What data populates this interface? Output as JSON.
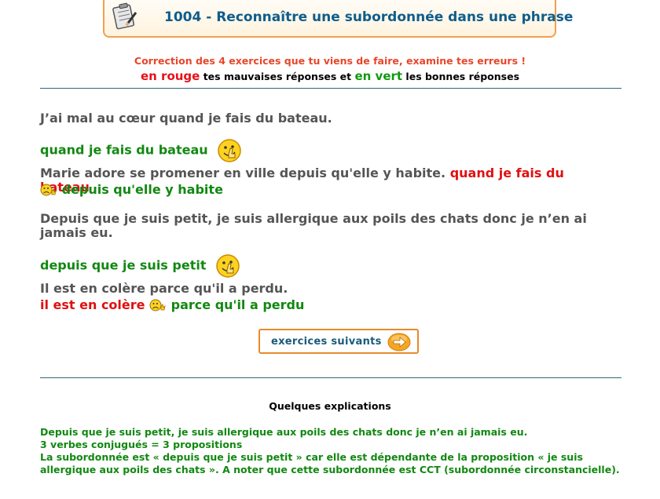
{
  "header": {
    "title": "1004 - Reconnaître une subordonnée dans une phrase",
    "icon": "clipboard-pencil-icon"
  },
  "intro": {
    "line1": "Correction des 4 exercices que tu viens de faire, examine tes erreurs !",
    "red_label": "en rouge",
    "middle": " tes mauvaises réponses et ",
    "green_label": "en vert",
    "end": " les bonnes réponses"
  },
  "exercises": [
    {
      "question": "J’ai mal au cœur quand je fais du bateau.",
      "correct": "quand je fais du bateau",
      "result_icon": "thumbs-up-smiley-icon"
    },
    {
      "question": "Marie adore se promener en ville depuis qu'elle y habite.",
      "wrong": "quand je fais du bateau",
      "correct": "depuis qu'elle y habite",
      "result_icon": "sad-smiley-icon"
    },
    {
      "question": "Depuis que je suis petit, je suis allergique aux poils des chats donc je n’en ai jamais eu.",
      "correct": "depuis que je suis petit",
      "result_icon": "thumbs-up-smiley-icon"
    },
    {
      "question": "Il est en colère parce qu'il a perdu.",
      "wrong": "il est en colère",
      "correct": "parce qu'il a perdu",
      "result_icon": "sad-smiley-icon"
    }
  ],
  "next_button": {
    "label": "exercices suivants",
    "icon": "arrow-right-icon"
  },
  "explanations": {
    "title": "Quelques explications",
    "lines": [
      "Depuis que je suis petit, je suis allergique aux poils des chats donc je n’en ai jamais eu.",
      "3 verbes conjugués = 3 propositions",
      "La subordonnée est « depuis que je suis petit » car elle est dépendante de la proposition « je suis allergique aux poils des chats ». A noter que cette subordonnée est CCT (subordonnée circonstancielle)."
    ]
  },
  "colors": {
    "title": "#0e5d8c",
    "wrong": "#e01010",
    "correct": "#118811",
    "question": "#555555",
    "button_border": "#e88a2c"
  }
}
